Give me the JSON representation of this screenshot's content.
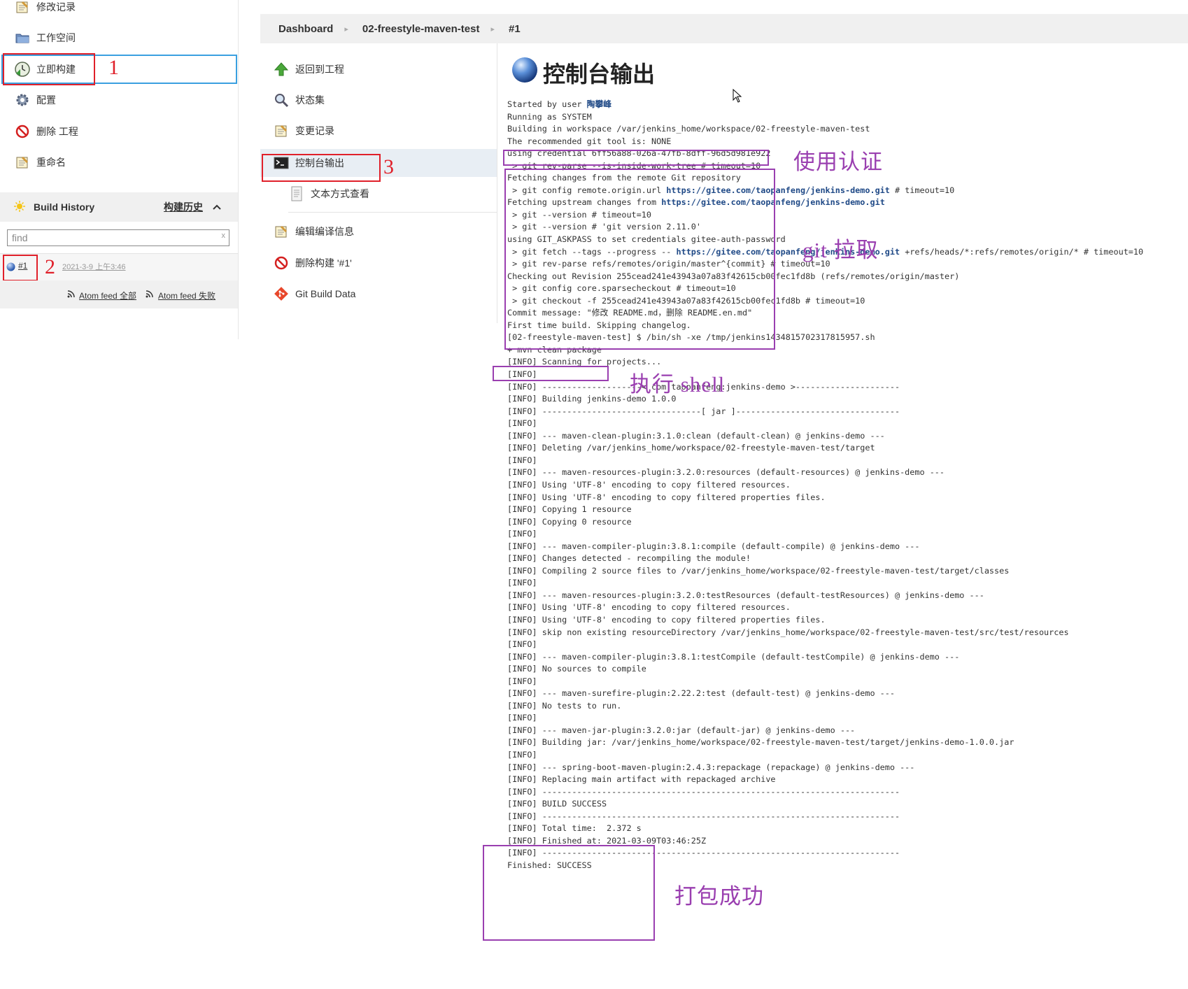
{
  "left_tasks": [
    {
      "label": "修改记录",
      "icon": "notepad-icon"
    },
    {
      "label": "工作空间",
      "icon": "folder-icon"
    },
    {
      "label": "立即构建",
      "icon": "build-clock-icon"
    },
    {
      "label": "配置",
      "icon": "gear-icon"
    },
    {
      "label": "删除 工程",
      "icon": "no-entry-icon"
    },
    {
      "label": "重命名",
      "icon": "notepad-icon"
    }
  ],
  "build_history": {
    "title": "Build History",
    "title_cn": "构建历史",
    "search_placeholder": "find",
    "search_clear": "x",
    "build_number": "#1",
    "build_time": "2021-3-9 上午3:46",
    "feed_all": "Atom feed 全部",
    "feed_failed": "Atom feed 失败"
  },
  "breadcrumb": [
    "Dashboard",
    "02-freestyle-maven-test",
    "#1"
  ],
  "right_tasks": [
    {
      "label": "返回到工程",
      "icon": "arrow-up-icon"
    },
    {
      "label": "状态集",
      "icon": "magnifier-icon"
    },
    {
      "label": "变更记录",
      "icon": "notepad-icon"
    },
    {
      "label": "控制台输出",
      "icon": "terminal-icon"
    },
    {
      "label": "文本方式查看",
      "icon": "document-icon"
    },
    {
      "label": "编辑编译信息",
      "icon": "notepad-icon"
    },
    {
      "label": "删除构建 '#1'",
      "icon": "no-entry-icon"
    },
    {
      "label": "Git Build Data",
      "icon": "git-icon"
    }
  ],
  "console_title": "控制台输出",
  "console_user": "陶攀峰",
  "console_links": {
    "gitee_url": "https://gitee.com/taopanfeng/jenkins-demo.git"
  },
  "console_text": {
    "started_by": "Started by user ",
    "l02": "Running as SYSTEM",
    "l03": "Building in workspace /var/jenkins_home/workspace/02-freestyle-maven-test",
    "l04": "The recommended git tool is: NONE",
    "l05": "using credential 6ff56a88-026a-47fb-8dff-96d5d981e922",
    "l06": " > git rev-parse --is-inside-work-tree # timeout=10",
    "l07": "Fetching changes from the remote Git repository",
    "l08a": " > git config remote.origin.url ",
    "l08b": " # timeout=10",
    "l09a": "Fetching upstream changes from ",
    "l10": " > git --version # timeout=10",
    "l11": " > git --version # 'git version 2.11.0'",
    "l12": "using GIT_ASKPASS to set credentials gitee-auth-password",
    "l13a": " > git fetch --tags --progress -- ",
    "l13b": " +refs/heads/*:refs/remotes/origin/* # timeout=10",
    "l14": " > git rev-parse refs/remotes/origin/master^{commit} # timeout=10",
    "l15": "Checking out Revision 255cead241e43943a07a83f42615cb00fec1fd8b (refs/remotes/origin/master)",
    "l16": " > git config core.sparsecheckout # timeout=10",
    "l17": " > git checkout -f 255cead241e43943a07a83f42615cb00fec1fd8b # timeout=10",
    "l18": "Commit message: \"修改 README.md，删除 README.en.md\"",
    "l19": "First time build. Skipping changelog.",
    "l20": "[02-freestyle-maven-test] $ /bin/sh -xe /tmp/jenkins1434815702317815957.sh",
    "l21": "+ mvn clean package",
    "l22": "[INFO] Scanning for projects...",
    "l23": "[INFO]",
    "l24": "[INFO] --------------------< com.taopanfeng:jenkins-demo >---------------------",
    "l25": "[INFO] Building jenkins-demo 1.0.0",
    "l26": "[INFO] --------------------------------[ jar ]---------------------------------",
    "l27": "[INFO]",
    "l28": "[INFO] --- maven-clean-plugin:3.1.0:clean (default-clean) @ jenkins-demo ---",
    "l29": "[INFO] Deleting /var/jenkins_home/workspace/02-freestyle-maven-test/target",
    "l30": "[INFO]",
    "l31": "[INFO] --- maven-resources-plugin:3.2.0:resources (default-resources) @ jenkins-demo ---",
    "l32": "[INFO] Using 'UTF-8' encoding to copy filtered resources.",
    "l33": "[INFO] Using 'UTF-8' encoding to copy filtered properties files.",
    "l34": "[INFO] Copying 1 resource",
    "l35": "[INFO] Copying 0 resource",
    "l36": "[INFO]",
    "l37": "[INFO] --- maven-compiler-plugin:3.8.1:compile (default-compile) @ jenkins-demo ---",
    "l38": "[INFO] Changes detected - recompiling the module!",
    "l39": "[INFO] Compiling 2 source files to /var/jenkins_home/workspace/02-freestyle-maven-test/target/classes",
    "l40": "[INFO]",
    "l41": "[INFO] --- maven-resources-plugin:3.2.0:testResources (default-testResources) @ jenkins-demo ---",
    "l42": "[INFO] Using 'UTF-8' encoding to copy filtered resources.",
    "l43": "[INFO] Using 'UTF-8' encoding to copy filtered properties files.",
    "l44": "[INFO] skip non existing resourceDirectory /var/jenkins_home/workspace/02-freestyle-maven-test/src/test/resources",
    "l45": "[INFO]",
    "l46": "[INFO] --- maven-compiler-plugin:3.8.1:testCompile (default-testCompile) @ jenkins-demo ---",
    "l47": "[INFO] No sources to compile",
    "l48": "[INFO]",
    "l49": "[INFO] --- maven-surefire-plugin:2.22.2:test (default-test) @ jenkins-demo ---",
    "l50": "[INFO] No tests to run.",
    "l51": "[INFO]",
    "l52": "[INFO] --- maven-jar-plugin:3.2.0:jar (default-jar) @ jenkins-demo ---",
    "l53": "[INFO] Building jar: /var/jenkins_home/workspace/02-freestyle-maven-test/target/jenkins-demo-1.0.0.jar",
    "l54": "[INFO]",
    "l55": "[INFO] --- spring-boot-maven-plugin:2.4.3:repackage (repackage) @ jenkins-demo ---",
    "l56": "[INFO] Replacing main artifact with repackaged archive",
    "l57": "[INFO] ------------------------------------------------------------------------",
    "l58": "[INFO] BUILD SUCCESS",
    "l59": "[INFO] ------------------------------------------------------------------------",
    "l60": "[INFO] Total time:  2.372 s",
    "l61": "[INFO] Finished at: 2021-03-09T03:46:25Z",
    "l62": "[INFO] ------------------------------------------------------------------------",
    "l63": "Finished: SUCCESS"
  },
  "annotations": {
    "step1": "1",
    "step2": "2",
    "step3": "3",
    "credential": "使用认证",
    "git_pull": "git 拉取",
    "exec_shell": "执行 shell",
    "package_ok": "打包成功"
  },
  "colors": {
    "annotation_red": "#e0202a",
    "annotation_blue": "#3aa0e0",
    "annotation_purple": "#9a3fb0",
    "link_blue": "#204a87",
    "header_gray": "#f0f0f0"
  }
}
